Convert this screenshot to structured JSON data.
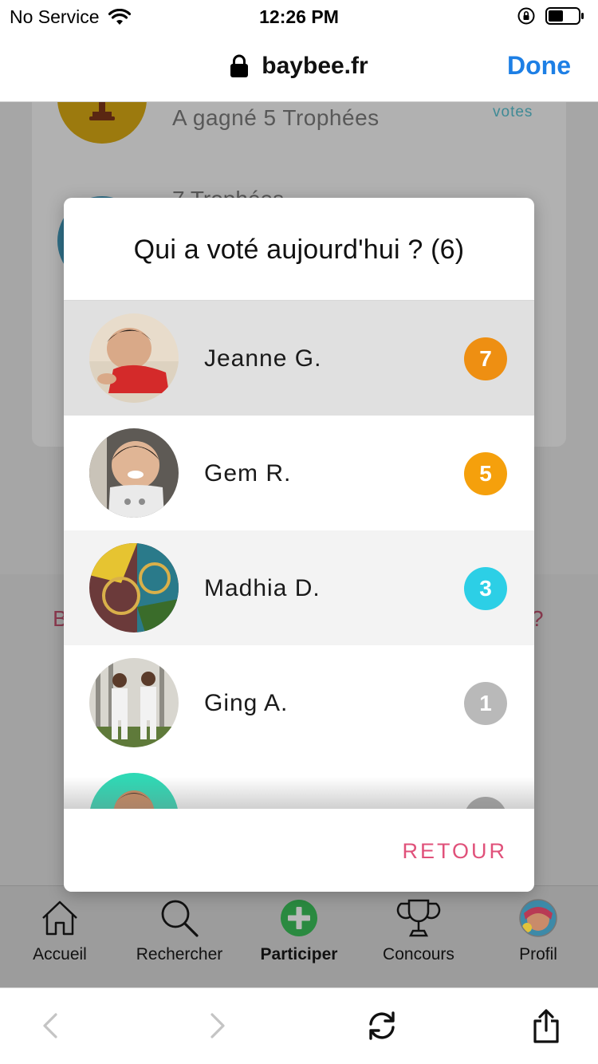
{
  "status_bar": {
    "carrier": "No Service",
    "time": "12:26 PM"
  },
  "browser": {
    "url": "baybee.fr",
    "done_label": "Done"
  },
  "background": {
    "trophy_text": "A gagné 5 Trophées",
    "votes_label": "votes",
    "second_text": "7 Trophées",
    "left_fragment": "B",
    "right_fragment": "?"
  },
  "modal": {
    "title": "Qui a voté aujourd'hui ? (6)",
    "voters": [
      {
        "name": "Jeanne G.",
        "count": "7",
        "badge_color": "#ee8f12"
      },
      {
        "name": "Gem R.",
        "count": "5",
        "badge_color": "#f5a00c"
      },
      {
        "name": "Madhia D.",
        "count": "3",
        "badge_color": "#2ccfe6"
      },
      {
        "name": "Ging A.",
        "count": "1",
        "badge_color": "#b9b9b9"
      },
      {
        "name": "",
        "count": "",
        "badge_color": "#a8a8a8"
      }
    ],
    "back_label": "RETOUR"
  },
  "tabbar": {
    "items": [
      {
        "label": "Accueil",
        "icon": "home-icon"
      },
      {
        "label": "Rechercher",
        "icon": "search-icon"
      },
      {
        "label": "Participer",
        "icon": "plus-circle-icon"
      },
      {
        "label": "Concours",
        "icon": "trophy-icon"
      },
      {
        "label": "Profil",
        "icon": "profile-avatar"
      }
    ]
  },
  "toolbar": {
    "buttons": [
      "back-icon",
      "forward-icon",
      "reload-icon",
      "share-icon"
    ]
  },
  "colors": {
    "accent_blue": "#1d7fe5",
    "retour_pink": "#e0517a",
    "participer_green": "#2aa24a"
  }
}
